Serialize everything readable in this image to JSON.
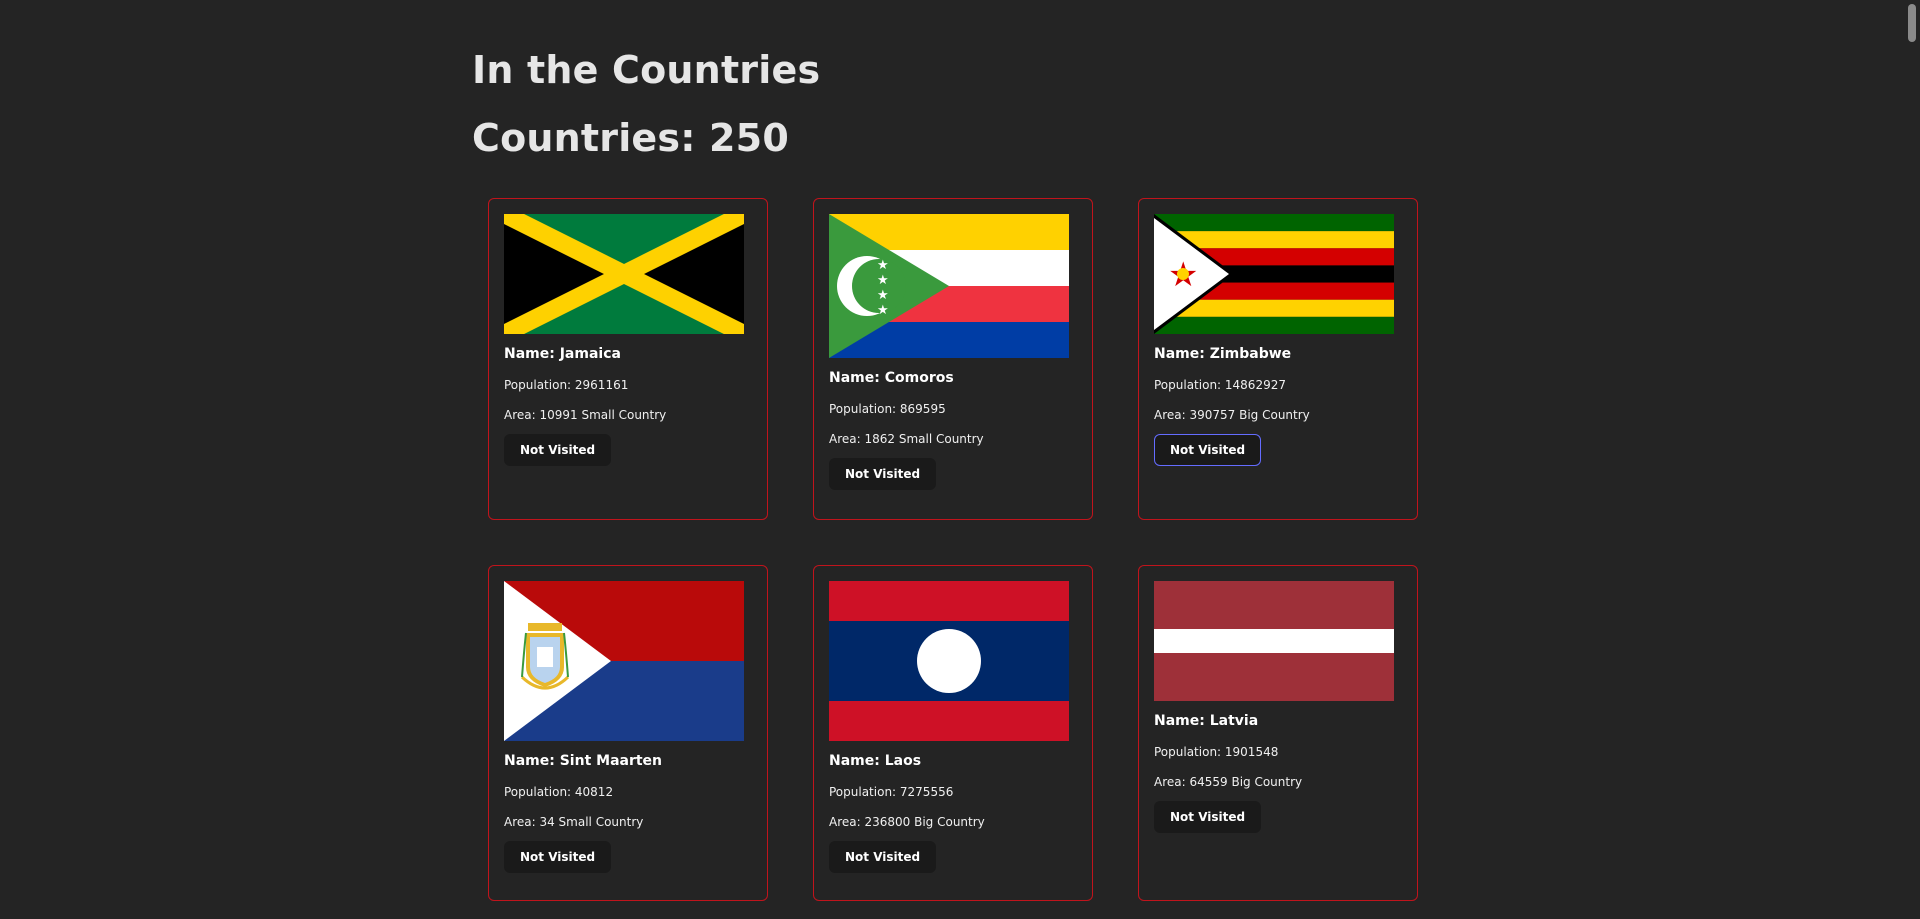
{
  "header": {
    "title": "In the Countries",
    "count_label": "Countries: 250"
  },
  "colors": {
    "background": "#242424",
    "card_border": "#c0141c",
    "button_bg": "#1a1a1a",
    "button_focus_border": "#646cff"
  },
  "countries": [
    {
      "name": "Name: Jamaica",
      "population": "Population: 2961161",
      "area": "Area: 10991 Small Country",
      "button": "Not Visited",
      "flag": "jamaica-flag"
    },
    {
      "name": "Name: Comoros",
      "population": "Population: 869595",
      "area": "Area: 1862 Small Country",
      "button": "Not Visited",
      "flag": "comoros-flag"
    },
    {
      "name": "Name: Zimbabwe",
      "population": "Population: 14862927",
      "area": "Area: 390757 Big Country",
      "button": "Not Visited",
      "flag": "zimbabwe-flag"
    },
    {
      "name": "Name: Sint Maarten",
      "population": "Population: 40812",
      "area": "Area: 34 Small Country",
      "button": "Not Visited",
      "flag": "sint-maarten-flag"
    },
    {
      "name": "Name: Laos",
      "population": "Population: 7275556",
      "area": "Area: 236800 Big Country",
      "button": "Not Visited",
      "flag": "laos-flag"
    },
    {
      "name": "Name: Latvia",
      "population": "Population: 1901548",
      "area": "Area: 64559 Big Country",
      "button": "Not Visited",
      "flag": "latvia-flag"
    }
  ]
}
